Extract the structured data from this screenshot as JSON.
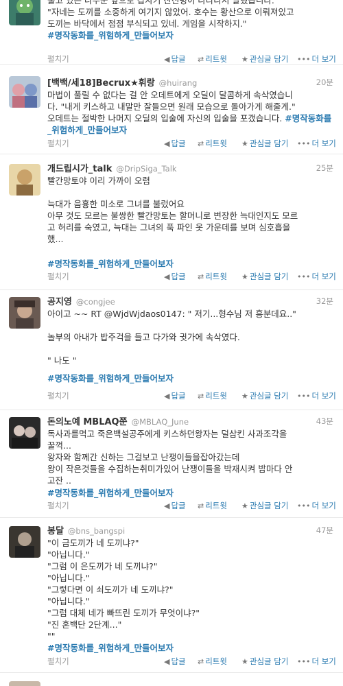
{
  "actions": {
    "expand": "펼치기",
    "reply": "답글",
    "retweet": "리트윗",
    "favorite": "관심글 담기",
    "more": "더 보기"
  },
  "tweets": [
    {
      "name": "",
      "handle": "",
      "time": "",
      "lines": [
        "울고 있는 나무꾼 앞으로 갑자기 산신령이 나타나서 말했습니다.",
        "\"자네는 도끼를 소중하게 여기지 않았어. 호수는 황산으로 이뤄져있고",
        "도끼는 바닥에서 점점 부식되고 있네. 게임을 시작하지.\""
      ],
      "hashtag": "#명작동화를_위험하게_만들어보자"
    },
    {
      "name": "[백백/세18]Becrux★휘랑",
      "handle": "@huirang",
      "time": "20분",
      "lines": [
        "마법이 풀릴 수 없다는 걸 안 오데트에게 오딜이 달콤하게 속삭였습니",
        "다. \"내게 키스하고 내말만 잘들으면 원래 모습으로 돌아가게 해줄게.\"",
        "오데트는 절박한 나머지 오딜의 입술에 자신의 입술을 포갰습니다."
      ],
      "hashtag": "#명작동화를_위험하게_만들어보자"
    },
    {
      "name": "개드립시가_talk",
      "handle": "@DripSiga_Talk",
      "time": "25분",
      "lines": [
        "빨간망토야 이리 가까이 오렴",
        "",
        "늑대가 음흉한 미소로 그녀를 불렀어요",
        "아무 것도 모르는 불쌍한 빨간망토는 할머니로 변장한 늑대인지도 모르",
        "고 허리를 숙였고, 늑대는 그녀의 푹 파인 옷 가운데를 보며 심호흡을",
        "했...",
        ""
      ],
      "hashtag": "#명작동화를_위험하게_만들어보자"
    },
    {
      "name": "공지영",
      "handle": "@congjee",
      "time": "32분",
      "lines": [
        "아이고 ~~ RT @WjdWjdaos0147: \" 저기...형수님 저 흥분데요..\"",
        "",
        "놀부의 아내가 밥주걱을 들고 다가와 귓가에 속삭였다.",
        "",
        "\" 나도 \""
      ],
      "hashtag": "#명작동화를_위험하게_만들어보자"
    },
    {
      "name": "돈의노예 MBLAQ쭌",
      "handle": "@MBLAQ_June",
      "time": "43분",
      "lines": [
        "독사과를먹고 죽은백설공주에게 키스하던왕자는 덜삼킨 사과조각을",
        "꿀꺽...",
        "왕자와 함께간 신하는 그걸보고 난쟁이들을잡아갔는데",
        "왕이 작은것들을 수집하는취미가있어 난쟁이들을 박재시켜 밤마다 안",
        "고잔 .."
      ],
      "hashtag": " #명작동화를_위험하게_만들어보자"
    },
    {
      "name": "봉달",
      "handle": "@bns_bangspi",
      "time": "47분",
      "lines": [
        "\"이 금도끼가 네 도끼냐?\"",
        "\"아닙니다.\"",
        "\"그럼 이 은도끼가 네 도끼냐?\"",
        "\"아닙니다.\"",
        "\"그렇다면 이 쇠도끼가 네 도끼냐?\"",
        "\"아닙니다.\"",
        "\"그럼 대체 네가 빠뜨린 도끼가 무엇이냐?\"",
        "\"진 혼백단 2단계...\"",
        "\"\""
      ],
      "hashtag": "#명작동화를_위험하게_만들어보자"
    }
  ],
  "colors": {
    "link": "#2a7ab0",
    "muted": "#999999",
    "divider": "#e8e8e8"
  }
}
